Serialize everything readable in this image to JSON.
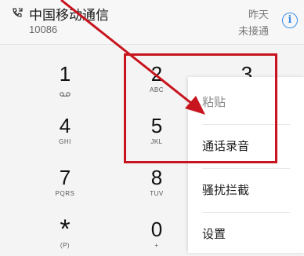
{
  "call_log": {
    "name": "中国移动通信",
    "number": "10086",
    "time": "昨天",
    "status": "未接通",
    "icons": {
      "call_type": "missed-call-icon",
      "info": "info-icon"
    },
    "info_glyph": "i"
  },
  "dialpad": {
    "keys": [
      {
        "digit": "1",
        "letters": "",
        "icon": "voicemail-icon"
      },
      {
        "digit": "2",
        "letters": "ABC"
      },
      {
        "digit": "3",
        "letters": ""
      },
      {
        "digit": "4",
        "letters": "GHI"
      },
      {
        "digit": "5",
        "letters": "JKL"
      },
      {
        "digit": "7",
        "letters": "PQRS"
      },
      {
        "digit": "8",
        "letters": "TUV"
      },
      {
        "digit": "*",
        "letters": "(P)"
      },
      {
        "digit": "0",
        "letters": "+"
      }
    ]
  },
  "context_menu": {
    "items": [
      {
        "label": "粘贴",
        "enabled": false
      },
      {
        "label": "通话录音",
        "enabled": true
      },
      {
        "label": "骚扰拦截",
        "enabled": true
      },
      {
        "label": "设置",
        "enabled": true
      }
    ]
  },
  "annotation": {
    "color": "#c8141e"
  },
  "colors": {
    "accent": "#3a8ee6",
    "background": "#f4f4f4"
  }
}
